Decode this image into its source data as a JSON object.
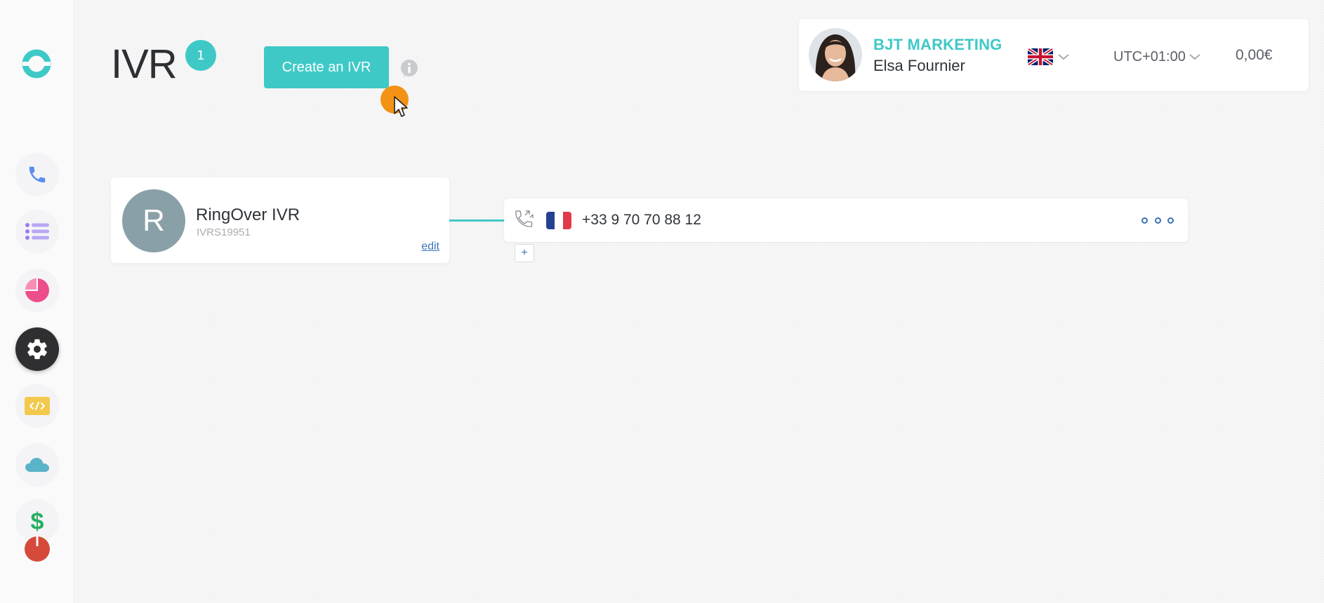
{
  "header": {
    "title": "IVR",
    "count": "1",
    "create_label": "Create an IVR"
  },
  "account": {
    "company": "BJT MARKETING",
    "user": "Elsa Fournier",
    "language_flag": "uk-flag-icon",
    "timezone": "UTC+01:00",
    "balance": "0,00€"
  },
  "sidebar": {
    "items": [
      {
        "name": "calls",
        "icon": "phone-icon",
        "color": "#5b8def"
      },
      {
        "name": "lists",
        "icon": "list-icon",
        "color": "#9b7cf0"
      },
      {
        "name": "statistics",
        "icon": "pie-chart-icon",
        "color": "#ee4d8c"
      },
      {
        "name": "settings",
        "icon": "gear-icon",
        "color": "#ffffff",
        "active": true
      },
      {
        "name": "developer",
        "icon": "code-icon",
        "color": "#f2c94c"
      },
      {
        "name": "integrations",
        "icon": "cloud-icon",
        "color": "#5ab3c9"
      },
      {
        "name": "billing",
        "icon": "dollar-icon",
        "color": "#27ae60"
      },
      {
        "name": "logout",
        "icon": "power-icon",
        "color": "#d64a3b"
      }
    ]
  },
  "ivr": {
    "initial": "R",
    "name": "RingOver IVR",
    "id": "IVRS19951",
    "edit_label": "edit",
    "number": "+33 9 70 70 88 12",
    "add_label": "+"
  },
  "colors": {
    "accent": "#3ec9c7",
    "link": "#3b74b7",
    "cursor_highlight": "#f39214"
  }
}
